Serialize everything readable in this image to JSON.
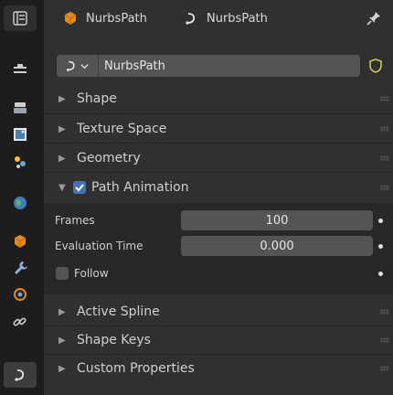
{
  "header": {
    "object_name": "NurbsPath",
    "data_name": "NurbsPath"
  },
  "datablock": {
    "name": "NurbsPath"
  },
  "panels": {
    "shape": "Shape",
    "texture_space": "Texture Space",
    "geometry": "Geometry",
    "path_animation": "Path Animation",
    "active_spline": "Active Spline",
    "shape_keys": "Shape Keys",
    "custom_properties": "Custom Properties"
  },
  "path_animation": {
    "enabled": true,
    "frames_label": "Frames",
    "frames_value": "100",
    "eval_time_label": "Evaluation Time",
    "eval_time_value": "0.000",
    "follow_label": "Follow",
    "follow_checked": false
  },
  "colors": {
    "accent": "#4772b3",
    "object_orange": "#e8891c",
    "shield_yellow": "#c8c35a"
  },
  "sidebar_icons": [
    "tool-icon",
    "render-icon",
    "output-icon",
    "view-layer-icon",
    "scene-icon",
    "world-icon",
    "object-icon",
    "modifier-icon",
    "physics-icon",
    "constraint-icon",
    "curve-data-icon"
  ]
}
